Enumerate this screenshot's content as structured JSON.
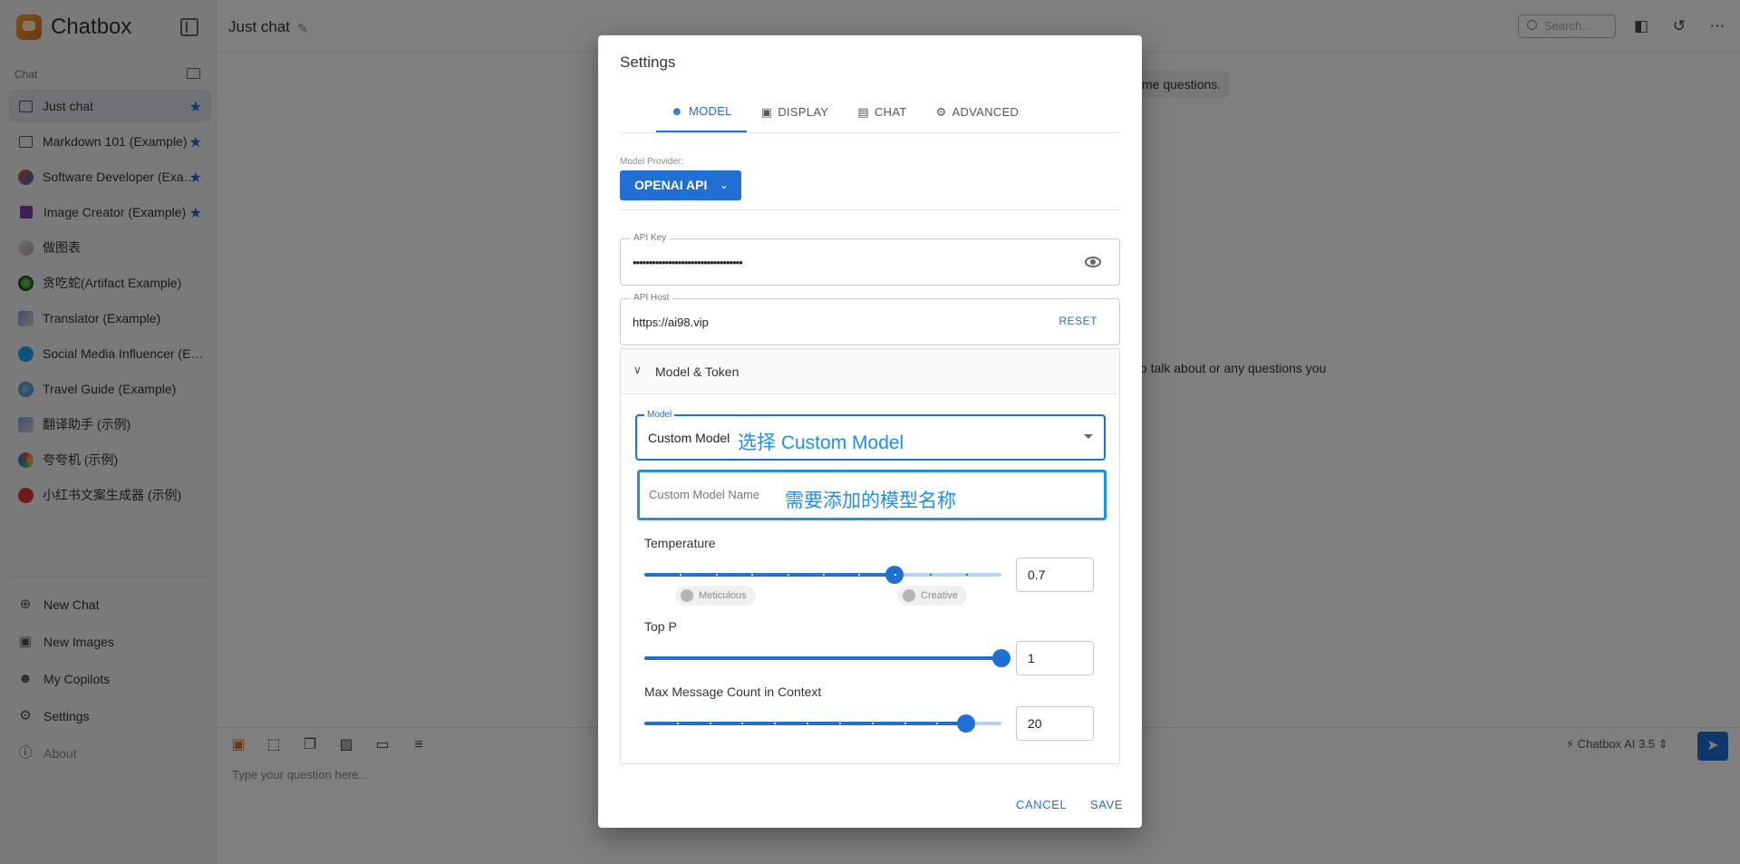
{
  "app": {
    "name": "Chatbox"
  },
  "sidebar": {
    "section_label": "Chat",
    "chats": [
      {
        "label": "Just chat",
        "icon": "chat-bubble-icon",
        "starred": true,
        "active": true
      },
      {
        "label": "Markdown 101 (Example)",
        "icon": "chat-bubble-icon",
        "starred": true
      },
      {
        "label": "Software Developer (Example)",
        "icon": "developer-avatar",
        "starred": true
      },
      {
        "label": "Image Creator (Example)",
        "icon": "image-icon",
        "starred": true
      },
      {
        "label": "做图表",
        "icon": "chart-avatar"
      },
      {
        "label": "贪吃蛇(Artifact Example)",
        "icon": "snake-avatar"
      },
      {
        "label": "Translator (Example)",
        "icon": "translator-avatar"
      },
      {
        "label": "Social Media Influencer (Example)",
        "icon": "twitter-avatar"
      },
      {
        "label": "Travel Guide (Example)",
        "icon": "globe-avatar"
      },
      {
        "label": "翻译助手 (示例)",
        "icon": "translator-avatar"
      },
      {
        "label": "夸夸机 (示例)",
        "icon": "praise-avatar"
      },
      {
        "label": "小红书文案生成器 (示例)",
        "icon": "xiaohongshu-avatar"
      }
    ],
    "menu": [
      {
        "label": "New Chat",
        "icon": "plus-circle-icon"
      },
      {
        "label": "New Images",
        "icon": "new-image-icon"
      },
      {
        "label": "My Copilots",
        "icon": "robot-icon"
      },
      {
        "label": "Settings",
        "icon": "gear-icon"
      },
      {
        "label": "About",
        "icon": "info-icon"
      }
    ]
  },
  "header": {
    "title": "Just chat",
    "search_placeholder": "Search..."
  },
  "conversation": {
    "snippet_1": "me questions.",
    "snippet_2": "to talk about or any questions you"
  },
  "composer": {
    "placeholder": "Type your question here...",
    "model": "Chatbox AI 3.5"
  },
  "settings": {
    "title": "Settings",
    "tabs": [
      {
        "label": "MODEL",
        "icon": "robot-icon",
        "active": true
      },
      {
        "label": "DISPLAY",
        "icon": "display-icon"
      },
      {
        "label": "CHAT",
        "icon": "chat-icon"
      },
      {
        "label": "ADVANCED",
        "icon": "gear-icon"
      }
    ],
    "provider_label": "Model Provider:",
    "provider_value": "OPENAI API",
    "api_key_label": "API Key",
    "api_key_value": "••••••••••••••••••••••••••••••••••",
    "api_host_label": "API Host",
    "api_host_value": "https://ai98.vip",
    "reset_label": "RESET",
    "accordion_title": "Model & Token",
    "model_label": "Model",
    "model_value": "Custom Model",
    "model_annotation": "选择 Custom Model",
    "custom_model_placeholder": "Custom Model Name",
    "custom_model_annotation": "需要添加的模型名称",
    "temperature": {
      "label": "Temperature",
      "value": "0.7",
      "fraction": 0.7,
      "low_label": "Meticulous",
      "high_label": "Creative"
    },
    "top_p": {
      "label": "Top P",
      "value": "1",
      "fraction": 1.0
    },
    "max_messages": {
      "label": "Max Message Count in Context",
      "value": "20",
      "fraction": 0.9
    },
    "cancel_label": "CANCEL",
    "save_label": "SAVE"
  },
  "colors": {
    "accent": "#1f6fd4",
    "annotation": "#1f8fe8"
  }
}
